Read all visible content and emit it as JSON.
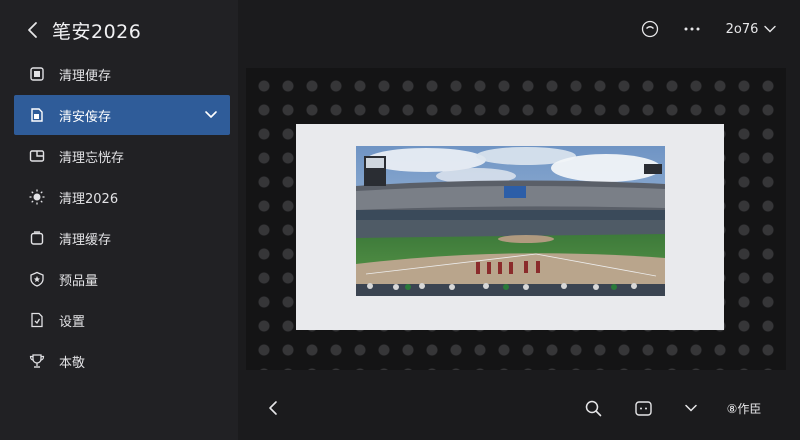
{
  "header": {
    "title": "笔安2026",
    "version_label": "2o76"
  },
  "sidebar": {
    "items": [
      {
        "label": "清理便存",
        "icon": "storage-icon"
      },
      {
        "label": "清安侫存",
        "icon": "document-icon",
        "active": true
      },
      {
        "label": "清理忘恍存",
        "icon": "gallery-icon"
      },
      {
        "label": "清理2026",
        "icon": "sun-icon"
      },
      {
        "label": "清理缓存",
        "icon": "folder-icon"
      },
      {
        "label": "预品量",
        "icon": "shield-icon"
      },
      {
        "label": "设置",
        "icon": "settings-doc-icon"
      },
      {
        "label": "本敬",
        "icon": "trophy-icon"
      }
    ]
  },
  "bottom": {
    "action_label": "⑧作臣"
  },
  "colors": {
    "accent": "#2f5c99",
    "background": "#1b1b1d",
    "sidebar": "#212124"
  }
}
